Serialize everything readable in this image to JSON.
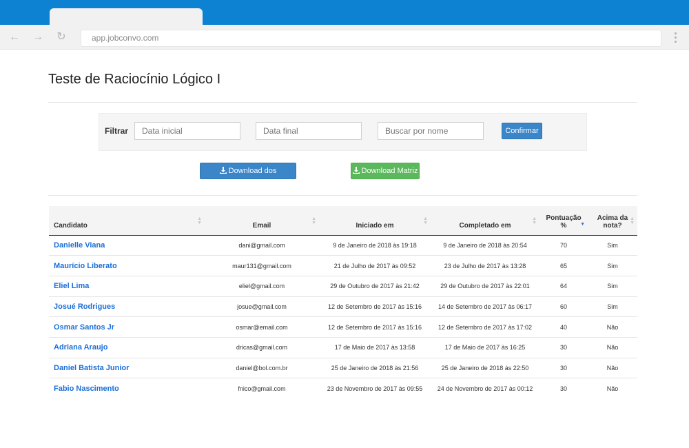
{
  "browser": {
    "url": "app.jobconvo.com"
  },
  "page": {
    "title": "Teste de Raciocínio Lógico I"
  },
  "filter": {
    "label": "Filtrar",
    "start_placeholder": "Data inicial",
    "end_placeholder": "Data final",
    "search_placeholder": "Buscar por nome",
    "confirm_label": "Confirmar"
  },
  "actions": {
    "download_results": "Download dos Resultados",
    "download_matrix": "Download Matriz"
  },
  "table": {
    "headers": {
      "candidate": "Candidato",
      "email": "Email",
      "started": "Iniciado em",
      "completed": "Completado em",
      "score_line1": "Pontuação",
      "score_line2": "%",
      "above_line1": "Acima da",
      "above_line2": "nota?"
    },
    "rows": [
      {
        "name": "Danielle Viana",
        "email": "dani@gmail.com",
        "started": "9 de Janeiro de 2018 às 19:18",
        "completed": "9 de Janeiro de 2018 às 20:54",
        "score": "70",
        "above": "Sim"
      },
      {
        "name": "Maurício Liberato",
        "email": "maur131@gmail.com",
        "started": "21 de Julho de 2017 às 09:52",
        "completed": "23 de Julho de 2017 às 13:28",
        "score": "65",
        "above": "Sim"
      },
      {
        "name": "Eliel Lima",
        "email": "eliel@gmail.com",
        "started": "29 de Outubro de 2017 às 21:42",
        "completed": "29 de Outubro de 2017 às 22:01",
        "score": "64",
        "above": "Sim"
      },
      {
        "name": "Josué Rodrigues",
        "email": "josue@gmail.com",
        "started": "12 de Setembro de 2017 às 15:16",
        "completed": "14 de Setembro de 2017 às 06:17",
        "score": "60",
        "above": "Sim"
      },
      {
        "name": "Osmar Santos Jr",
        "email": "osmar@email.com",
        "started": "12 de Setembro de 2017 às 15:16",
        "completed": "12 de Setembro de 2017 às 17:02",
        "score": "40",
        "above": "Não"
      },
      {
        "name": "Adriana Araujo",
        "email": "dricas@gmail.com",
        "started": "17 de Maio de 2017 às 13:58",
        "completed": "17 de Maio de 2017 às 16:25",
        "score": "30",
        "above": "Não"
      },
      {
        "name": "Daniel Batista Junior",
        "email": "daniel@bol.com.br",
        "started": "25 de Janeiro de 2018 às 21:56",
        "completed": "25 de Janeiro de 2018 às 22:50",
        "score": "30",
        "above": "Não"
      },
      {
        "name": "Fabio Nascimento",
        "email": "fnico@gmail.com",
        "started": "23 de Novembro de 2017 às 09:55",
        "completed": "24 de Novembro de 2017 às 00:12",
        "score": "30",
        "above": "Não"
      }
    ]
  },
  "colors": {
    "chrome_blue": "#0d82d2",
    "primary": "#3a86c8",
    "success": "#5cb85c",
    "link": "#1a6ed8"
  }
}
